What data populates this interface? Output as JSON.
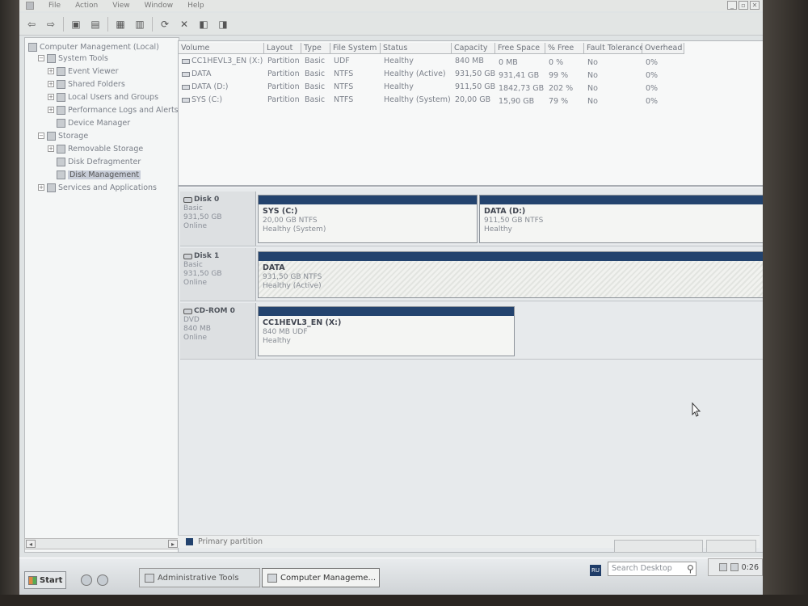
{
  "menu": [
    "File",
    "Action",
    "View",
    "Window",
    "Help"
  ],
  "window_controls": [
    "_",
    "▫",
    "✕"
  ],
  "tree": [
    {
      "label": "Computer Management (Local)",
      "level": 0,
      "expander": "",
      "icon": "computer-icon"
    },
    {
      "label": "System Tools",
      "level": 1,
      "expander": "−",
      "icon": "tools-icon"
    },
    {
      "label": "Event Viewer",
      "level": 2,
      "expander": "+",
      "icon": "event-viewer-icon"
    },
    {
      "label": "Shared Folders",
      "level": 2,
      "expander": "+",
      "icon": "folder-icon"
    },
    {
      "label": "Local Users and Groups",
      "level": 2,
      "expander": "+",
      "icon": "users-icon"
    },
    {
      "label": "Performance Logs and Alerts",
      "level": 2,
      "expander": "+",
      "icon": "performance-icon"
    },
    {
      "label": "Device Manager",
      "level": 2,
      "expander": "",
      "icon": "device-manager-icon"
    },
    {
      "label": "Storage",
      "level": 1,
      "expander": "−",
      "icon": "storage-icon"
    },
    {
      "label": "Removable Storage",
      "level": 2,
      "expander": "+",
      "icon": "removable-storage-icon"
    },
    {
      "label": "Disk Defragmenter",
      "level": 2,
      "expander": "",
      "icon": "defrag-icon"
    },
    {
      "label": "Disk Management",
      "level": 2,
      "expander": "",
      "icon": "disk-management-icon",
      "selected": true
    },
    {
      "label": "Services and Applications",
      "level": 1,
      "expander": "+",
      "icon": "services-icon"
    }
  ],
  "volume_table": {
    "columns": [
      "Volume",
      "Layout",
      "Type",
      "File System",
      "Status",
      "Capacity",
      "Free Space",
      "% Free",
      "Fault Tolerance",
      "Overhead"
    ],
    "rows": [
      [
        "CC1HEVL3_EN (X:)",
        "Partition",
        "Basic",
        "UDF",
        "Healthy",
        "840 MB",
        "0 MB",
        "0 %",
        "No",
        "0%"
      ],
      [
        "DATA",
        "Partition",
        "Basic",
        "NTFS",
        "Healthy (Active)",
        "931,50 GB",
        "931,41 GB",
        "99 %",
        "No",
        "0%"
      ],
      [
        "DATA (D:)",
        "Partition",
        "Basic",
        "NTFS",
        "Healthy",
        "911,50 GB",
        "1842,73 GB",
        "202 %",
        "No",
        "0%"
      ],
      [
        "SYS (C:)",
        "Partition",
        "Basic",
        "NTFS",
        "Healthy (System)",
        "20,00 GB",
        "15,90 GB",
        "79 %",
        "No",
        "0%"
      ]
    ]
  },
  "disks": [
    {
      "name": "Disk 0",
      "type": "Basic",
      "size": "931,50 GB",
      "state": "Online",
      "partitions": [
        {
          "name": "SYS (C:)",
          "size": "20,00 GB NTFS",
          "status": "Healthy (System)",
          "hatched": false
        },
        {
          "name": "DATA (D:)",
          "size": "911,50 GB NTFS",
          "status": "Healthy",
          "hatched": false
        }
      ]
    },
    {
      "name": "Disk 1",
      "type": "Basic",
      "size": "931,50 GB",
      "state": "Online",
      "partitions": [
        {
          "name": "DATA",
          "size": "931,50 GB NTFS",
          "status": "Healthy (Active)",
          "hatched": true
        }
      ]
    },
    {
      "name": "CD-ROM 0",
      "type": "DVD",
      "size": "840 MB",
      "state": "Online",
      "partitions": [
        {
          "name": "CC1HEVL3_EN (X:)",
          "size": "840 MB UDF",
          "status": "Healthy",
          "hatched": false
        }
      ]
    }
  ],
  "legend": {
    "primary_partition": "Primary partition",
    "color": "#23436e"
  },
  "taskbar": {
    "start_label": "Start",
    "tasks": [
      "Administrative Tools",
      "Computer Manageme..."
    ],
    "search_placeholder": "Search Desktop",
    "language": "RU",
    "clock": "0:26"
  }
}
